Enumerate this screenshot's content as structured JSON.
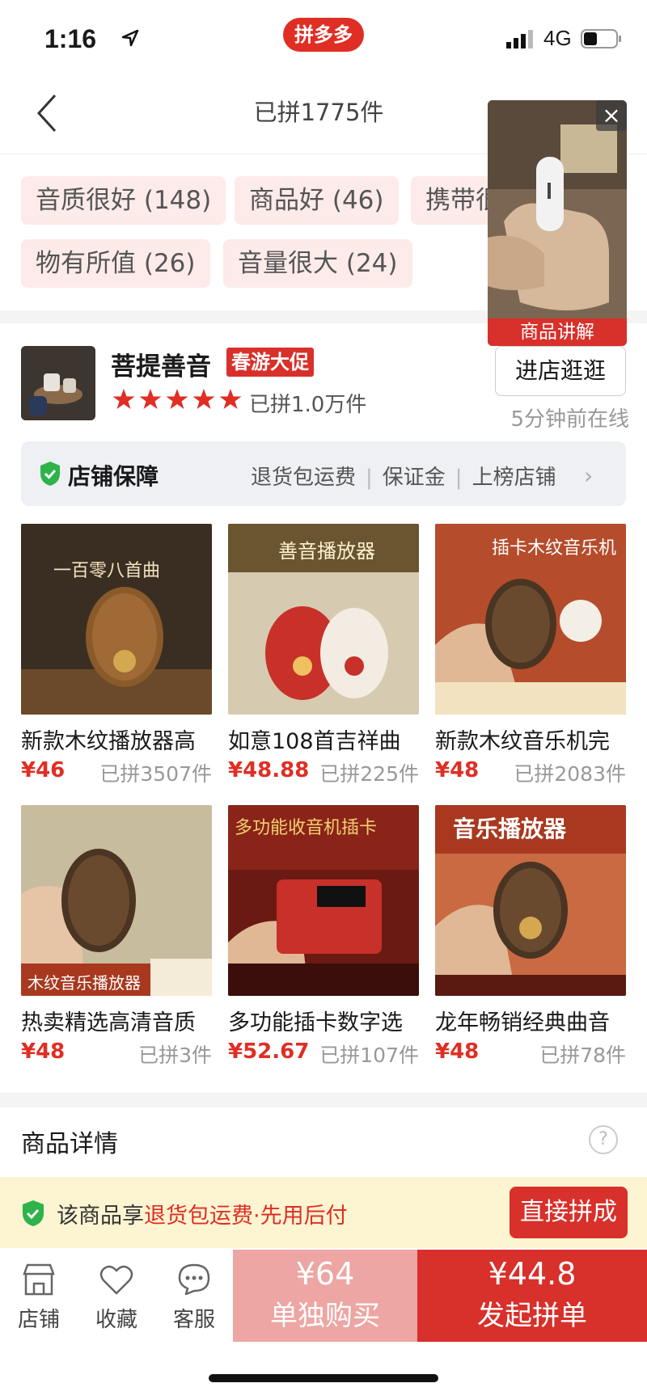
{
  "status_bar": {
    "time": "1:16",
    "network": "4G",
    "app_logo": "拼多多"
  },
  "header": {
    "title": "已拼1775件",
    "back_icon": "chevron-left-icon"
  },
  "tags": [
    {
      "label": "音质很好 (148)"
    },
    {
      "label": "商品好 (46)"
    },
    {
      "label": "携带很"
    },
    {
      "label": "物有所值 (26)"
    },
    {
      "label": "音量很大 (24)"
    }
  ],
  "video": {
    "caption": "商品讲解",
    "close_label": "×"
  },
  "store": {
    "name": "菩提善音",
    "promo": "春游大促",
    "rating_stars": 5,
    "sold": "已拼1.0万件",
    "enter_label": "进店逛逛",
    "online": "5分钟前在线"
  },
  "guarantee": {
    "title": "店铺保障",
    "items": [
      "退货包运费",
      "保证金",
      "上榜店铺"
    ]
  },
  "products": [
    {
      "name": "新款木纹播放器高",
      "price": "¥46",
      "sold": "已拼3507件",
      "img_text": "一百零八首曲"
    },
    {
      "name": "如意108首吉祥曲",
      "price": "¥48.88",
      "sold": "已拼225件",
      "img_text": "善音播放器"
    },
    {
      "name": "新款木纹音乐机完",
      "price": "¥48",
      "sold": "已拼2083件",
      "img_text": "插卡木纹音乐机"
    },
    {
      "name": "热卖精选高清音质",
      "price": "¥48",
      "sold": "已拼3件",
      "img_text": "木纹音乐播放器"
    },
    {
      "name": "多功能插卡数字选",
      "price": "¥52.67",
      "sold": "已拼107件",
      "img_text": "多功能收音机插卡"
    },
    {
      "name": "龙年畅销经典曲音",
      "price": "¥48",
      "sold": "已拼78件",
      "img_text": "音乐播放器"
    }
  ],
  "detail": {
    "title": "商品详情",
    "help_label": "?"
  },
  "promo_banner": {
    "prefix": "该商品享",
    "highlight": "退货包运费·先用后付",
    "button": "直接拼成"
  },
  "bottom_bar": {
    "store": "店铺",
    "favorite": "收藏",
    "service": "客服",
    "buy_alone_price": "¥64",
    "buy_alone_label": "单独购买",
    "group_price": "¥44.8",
    "group_label": "发起拼单"
  },
  "colors": {
    "brand": "#e02e24",
    "tag_bg": "#fcebe9",
    "banner_bg": "#fdf5d2"
  }
}
